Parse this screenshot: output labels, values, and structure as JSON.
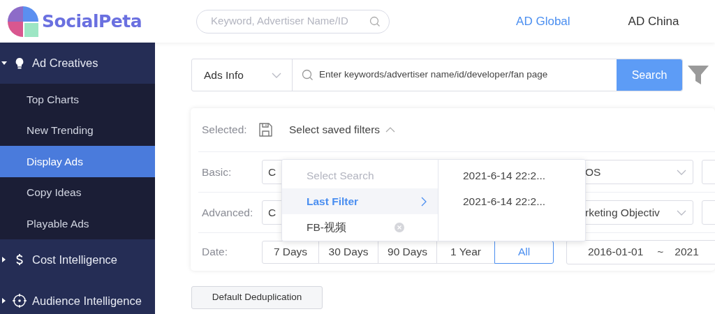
{
  "header": {
    "logo_text": "SocialPeta",
    "search": {
      "placeholder": "Keyword, Advertiser Name/ID"
    },
    "tabs": [
      {
        "label": "AD Global",
        "selected": true
      },
      {
        "label": "AD China",
        "selected": false
      }
    ]
  },
  "sidebar": {
    "items": [
      {
        "label": "Ad Creatives",
        "expanded": true,
        "children": [
          {
            "label": "Top Charts",
            "selected": false
          },
          {
            "label": "New Trending",
            "selected": false
          },
          {
            "label": "Display Ads",
            "selected": true
          },
          {
            "label": "Copy Ideas",
            "selected": false
          },
          {
            "label": "Playable Ads",
            "selected": false
          }
        ]
      },
      {
        "label": "Cost Intelligence",
        "expanded": false
      },
      {
        "label": "Audience Intelligence",
        "expanded": false
      }
    ]
  },
  "search_bar": {
    "scope": "Ads Info",
    "placeholder": "Enter keywords/advertiser name/id/developer/fan page",
    "button": "Search"
  },
  "filters": {
    "selected_label": "Selected:",
    "saved_filters": {
      "label": "Select saved filters",
      "expanded": true
    },
    "rows": [
      {
        "kind": "selects",
        "label": "Basic:",
        "selects": [
          "C",
          "OS"
        ]
      },
      {
        "kind": "selects",
        "label": "Advanced:",
        "selects": [
          "C",
          "rketing Objectiv"
        ]
      },
      {
        "kind": "date",
        "label": "Date:",
        "ranges": [
          {
            "label": "7 Days",
            "selected": false
          },
          {
            "label": "30 Days",
            "selected": false
          },
          {
            "label": "90 Days",
            "selected": false
          },
          {
            "label": "1 Year",
            "selected": false
          },
          {
            "label": "All",
            "selected": true
          }
        ],
        "date_from": "2016-01-01",
        "separator": "~",
        "date_to": "2021"
      }
    ],
    "dropdown": {
      "items": [
        {
          "kind": "placeholder",
          "label": "Select Search",
          "selected": false
        },
        {
          "kind": "submenu",
          "label": "Last Filter",
          "selected": true
        },
        {
          "kind": "saved",
          "label": "FB-视频",
          "selected": false
        }
      ],
      "submenu": [
        "2021-6-14 22:2...",
        "2021-6-14 22:2..."
      ]
    }
  },
  "dedupe_button": "Default Deduplication"
}
